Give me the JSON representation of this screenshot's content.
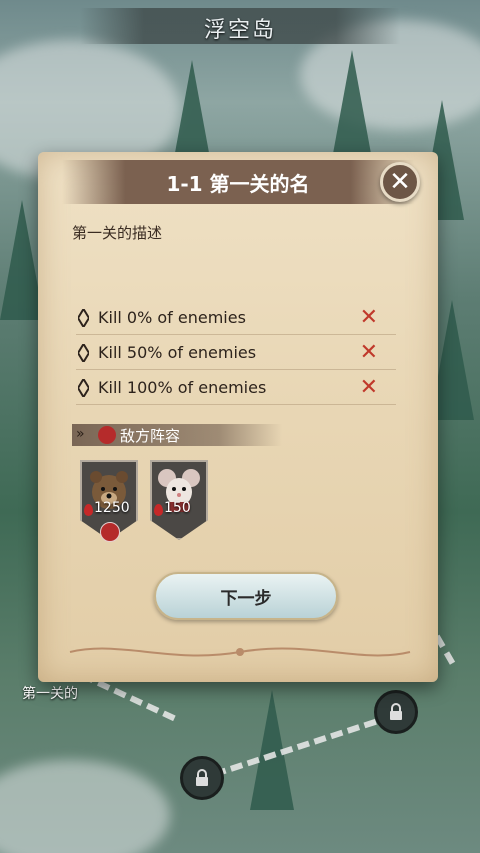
{
  "screen": {
    "title": "浮空岛"
  },
  "dialog": {
    "title": "1-1 第一关的名",
    "description": "第一关的描述",
    "close_icon": "close-icon",
    "objectives": [
      {
        "label": "Kill 0% of enemies",
        "status_icon": "cross-icon"
      },
      {
        "label": "Kill 50% of enemies",
        "status_icon": "cross-icon"
      },
      {
        "label": "Kill 100% of enemies",
        "status_icon": "cross-icon"
      }
    ],
    "enemy_section": {
      "label": "敌方阵容",
      "icon": "skull-icon"
    },
    "enemies": [
      {
        "name_icon": "bear-portrait",
        "value": "1250",
        "boss": true
      },
      {
        "name_icon": "mouse-portrait",
        "value": "150",
        "boss": false
      }
    ],
    "next_button": "下一步"
  },
  "map": {
    "node_label": "第一关的",
    "locked_nodes": [
      "lock-icon",
      "lock-icon"
    ]
  },
  "colors": {
    "panel": "#e8d6b4",
    "header": "#7b6150",
    "fail": "#c0392b"
  }
}
